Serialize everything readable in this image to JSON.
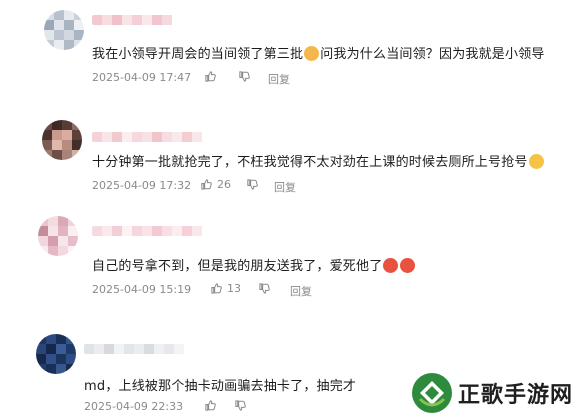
{
  "comments": [
    {
      "text": "我在小领导开周会的当间领了第三批",
      "text_after": "问我为什么当间领？因为我就是小领导",
      "emoji": "cat-face-emoji",
      "date": "2025-04-09 17:47",
      "likes": "",
      "reply_label": "回复"
    },
    {
      "text": "十分钟第一批就抢完了，不枉我觉得不太对劲在上课的时候去厕所上号抢号",
      "text_after": "",
      "emoji": "sweat-face-emoji",
      "date": "2025-04-09 17:32",
      "likes": "26",
      "reply_label": "回复"
    },
    {
      "text": "自己的号拿不到，但是我的朋友送我了，爱死他了",
      "text_after": "",
      "emoji": "heart-eyes-emoji",
      "date": "2025-04-09 15:19",
      "likes": "13",
      "reply_label": "回复"
    },
    {
      "text": "md，上线被那个抽卡动画骗去抽卡了，抽完才",
      "text_after": "",
      "emoji": "",
      "date": "2025-04-09 22:33",
      "likes": "",
      "reply_label": ""
    }
  ],
  "watermark": {
    "text": "正歌手游网"
  },
  "colors": {
    "meta_gray": "#8a8a8a",
    "text": "#1c1c1c",
    "watermark_green": "#2e8a3c"
  },
  "icons": {
    "like": "thumbs-up-icon",
    "dislike": "thumbs-down-icon"
  }
}
